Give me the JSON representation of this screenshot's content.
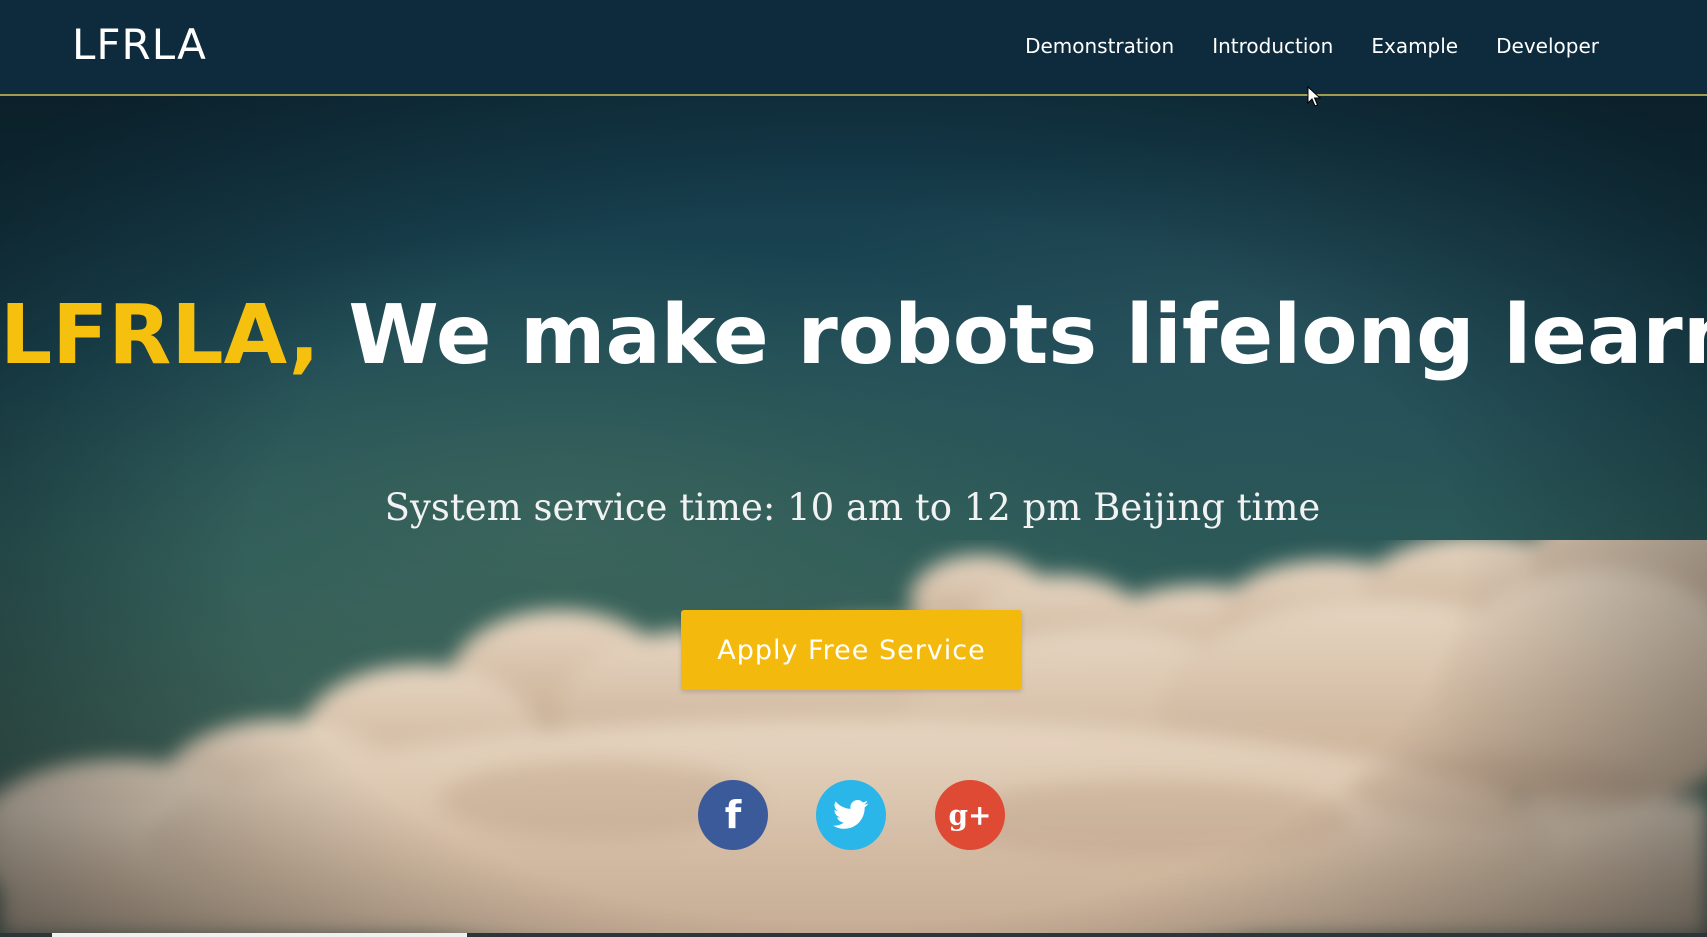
{
  "navbar": {
    "brand": "LFRLA",
    "links": [
      "Demonstration",
      "Introduction",
      "Example",
      "Developer"
    ]
  },
  "hero": {
    "headline_accent": "LFRLA,",
    "headline_rest": "We make robots lifelong learn !",
    "service_time": "System service time: 10 am to 12 pm Beijing time",
    "cta_label": "Apply Free Service"
  },
  "social": {
    "facebook_glyph": "f",
    "twitter_icon": "twitter-bird-icon",
    "googleplus_glyph": "g+"
  },
  "colors": {
    "accent": "#f4b90d",
    "navbar": "#0e2b3d",
    "facebook": "#3b5a9a",
    "twitter": "#2ab6e8",
    "googleplus": "#de4a34"
  }
}
